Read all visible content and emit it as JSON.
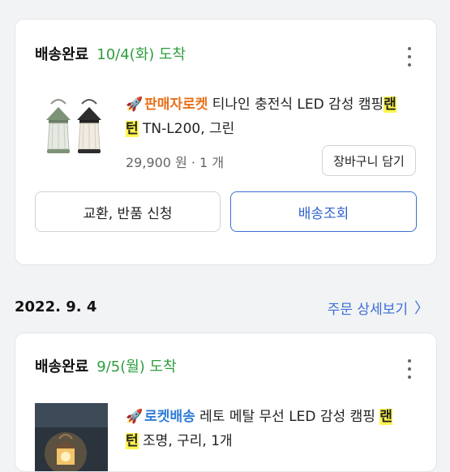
{
  "card1": {
    "status_label": "배송완료",
    "status_date": "10/4(화) 도착",
    "product": {
      "badge": "판매자로켓",
      "title_prefix": "티나인 충전식 LED 감성 캠핑",
      "title_hl1": "랜",
      "title_hl2": "턴",
      "title_suffix": "TN-L200, 그린",
      "price": "29,900 원 · 1 개"
    },
    "cart_button": "장바구니 담기",
    "exchange_button": "교환, 반품 신청",
    "track_button": "배송조회"
  },
  "order2": {
    "date": "2022. 9. 4",
    "detail_link": "주문 상세보기"
  },
  "card2": {
    "status_label": "배송완료",
    "status_date": "9/5(월) 도착",
    "product": {
      "badge": "로켓배송",
      "title_prefix": "레토 메탈 무선 LED 감성 캠핑",
      "title_hl1": "랜",
      "title_hl2": "턴",
      "title_suffix": "조명, 구리, 1개"
    }
  },
  "colors": {
    "delivered_green": "#2e9e3e",
    "link_blue": "#3b6fd6",
    "badge_orange": "#e8701a",
    "highlight_yellow": "#fff64d"
  },
  "icons": {
    "badge": "rocket-icon",
    "more": "more-vertical-icon",
    "chevron": "chevron-right-icon"
  }
}
